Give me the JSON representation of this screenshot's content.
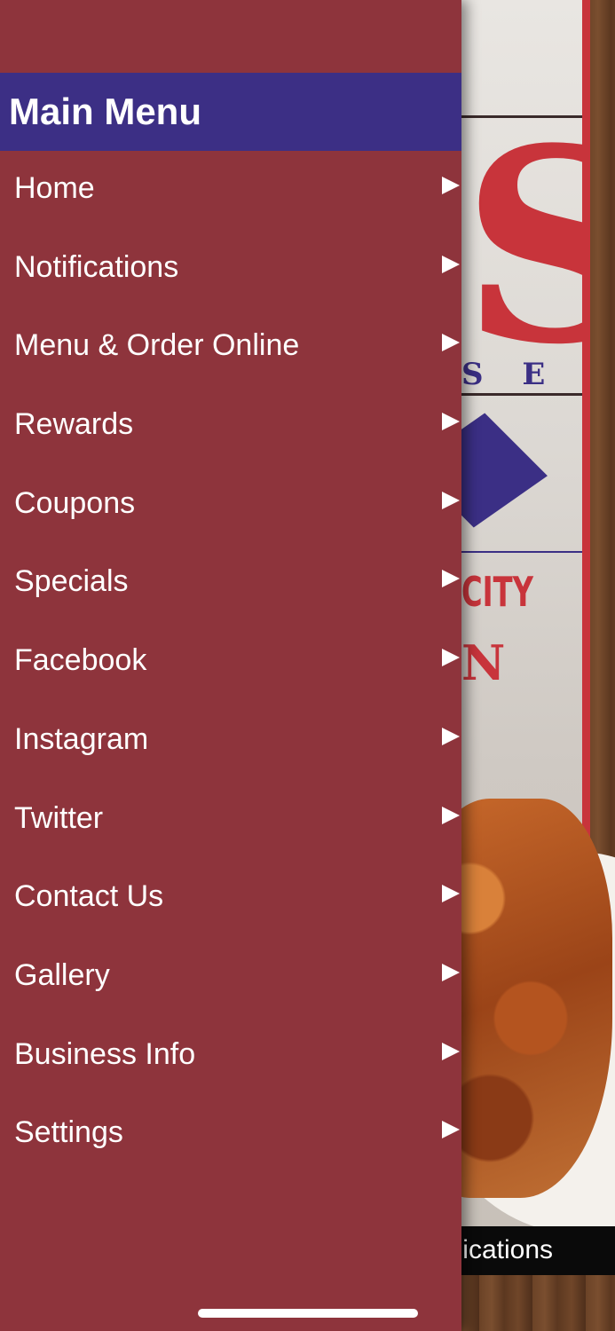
{
  "drawer": {
    "title": "Main Menu",
    "items": [
      {
        "label": "Home",
        "icon": "play-arrow-icon"
      },
      {
        "label": "Notifications",
        "icon": "play-arrow-icon"
      },
      {
        "label": "Menu & Order Online",
        "icon": "play-arrow-icon"
      },
      {
        "label": "Rewards",
        "icon": "play-arrow-icon"
      },
      {
        "label": "Coupons",
        "icon": "play-arrow-icon"
      },
      {
        "label": "Specials",
        "icon": "play-arrow-icon"
      },
      {
        "label": "Facebook",
        "icon": "play-arrow-icon"
      },
      {
        "label": "Instagram",
        "icon": "play-arrow-icon"
      },
      {
        "label": "Twitter",
        "icon": "play-arrow-icon"
      },
      {
        "label": "Contact Us",
        "icon": "play-arrow-icon"
      },
      {
        "label": "Gallery",
        "icon": "play-arrow-icon"
      },
      {
        "label": "Business Info",
        "icon": "play-arrow-icon"
      },
      {
        "label": "Settings",
        "icon": "play-arrow-icon"
      }
    ]
  },
  "background": {
    "poster_letter": "S",
    "poster_subtext": "S E",
    "poster_city": "CITY",
    "poster_partial": "N",
    "bottom_bar_text": "ications"
  },
  "colors": {
    "drawer_bg": "#8e343c",
    "header_bg": "#3c2f85",
    "accent_red": "#c8343b",
    "text": "#ffffff"
  }
}
